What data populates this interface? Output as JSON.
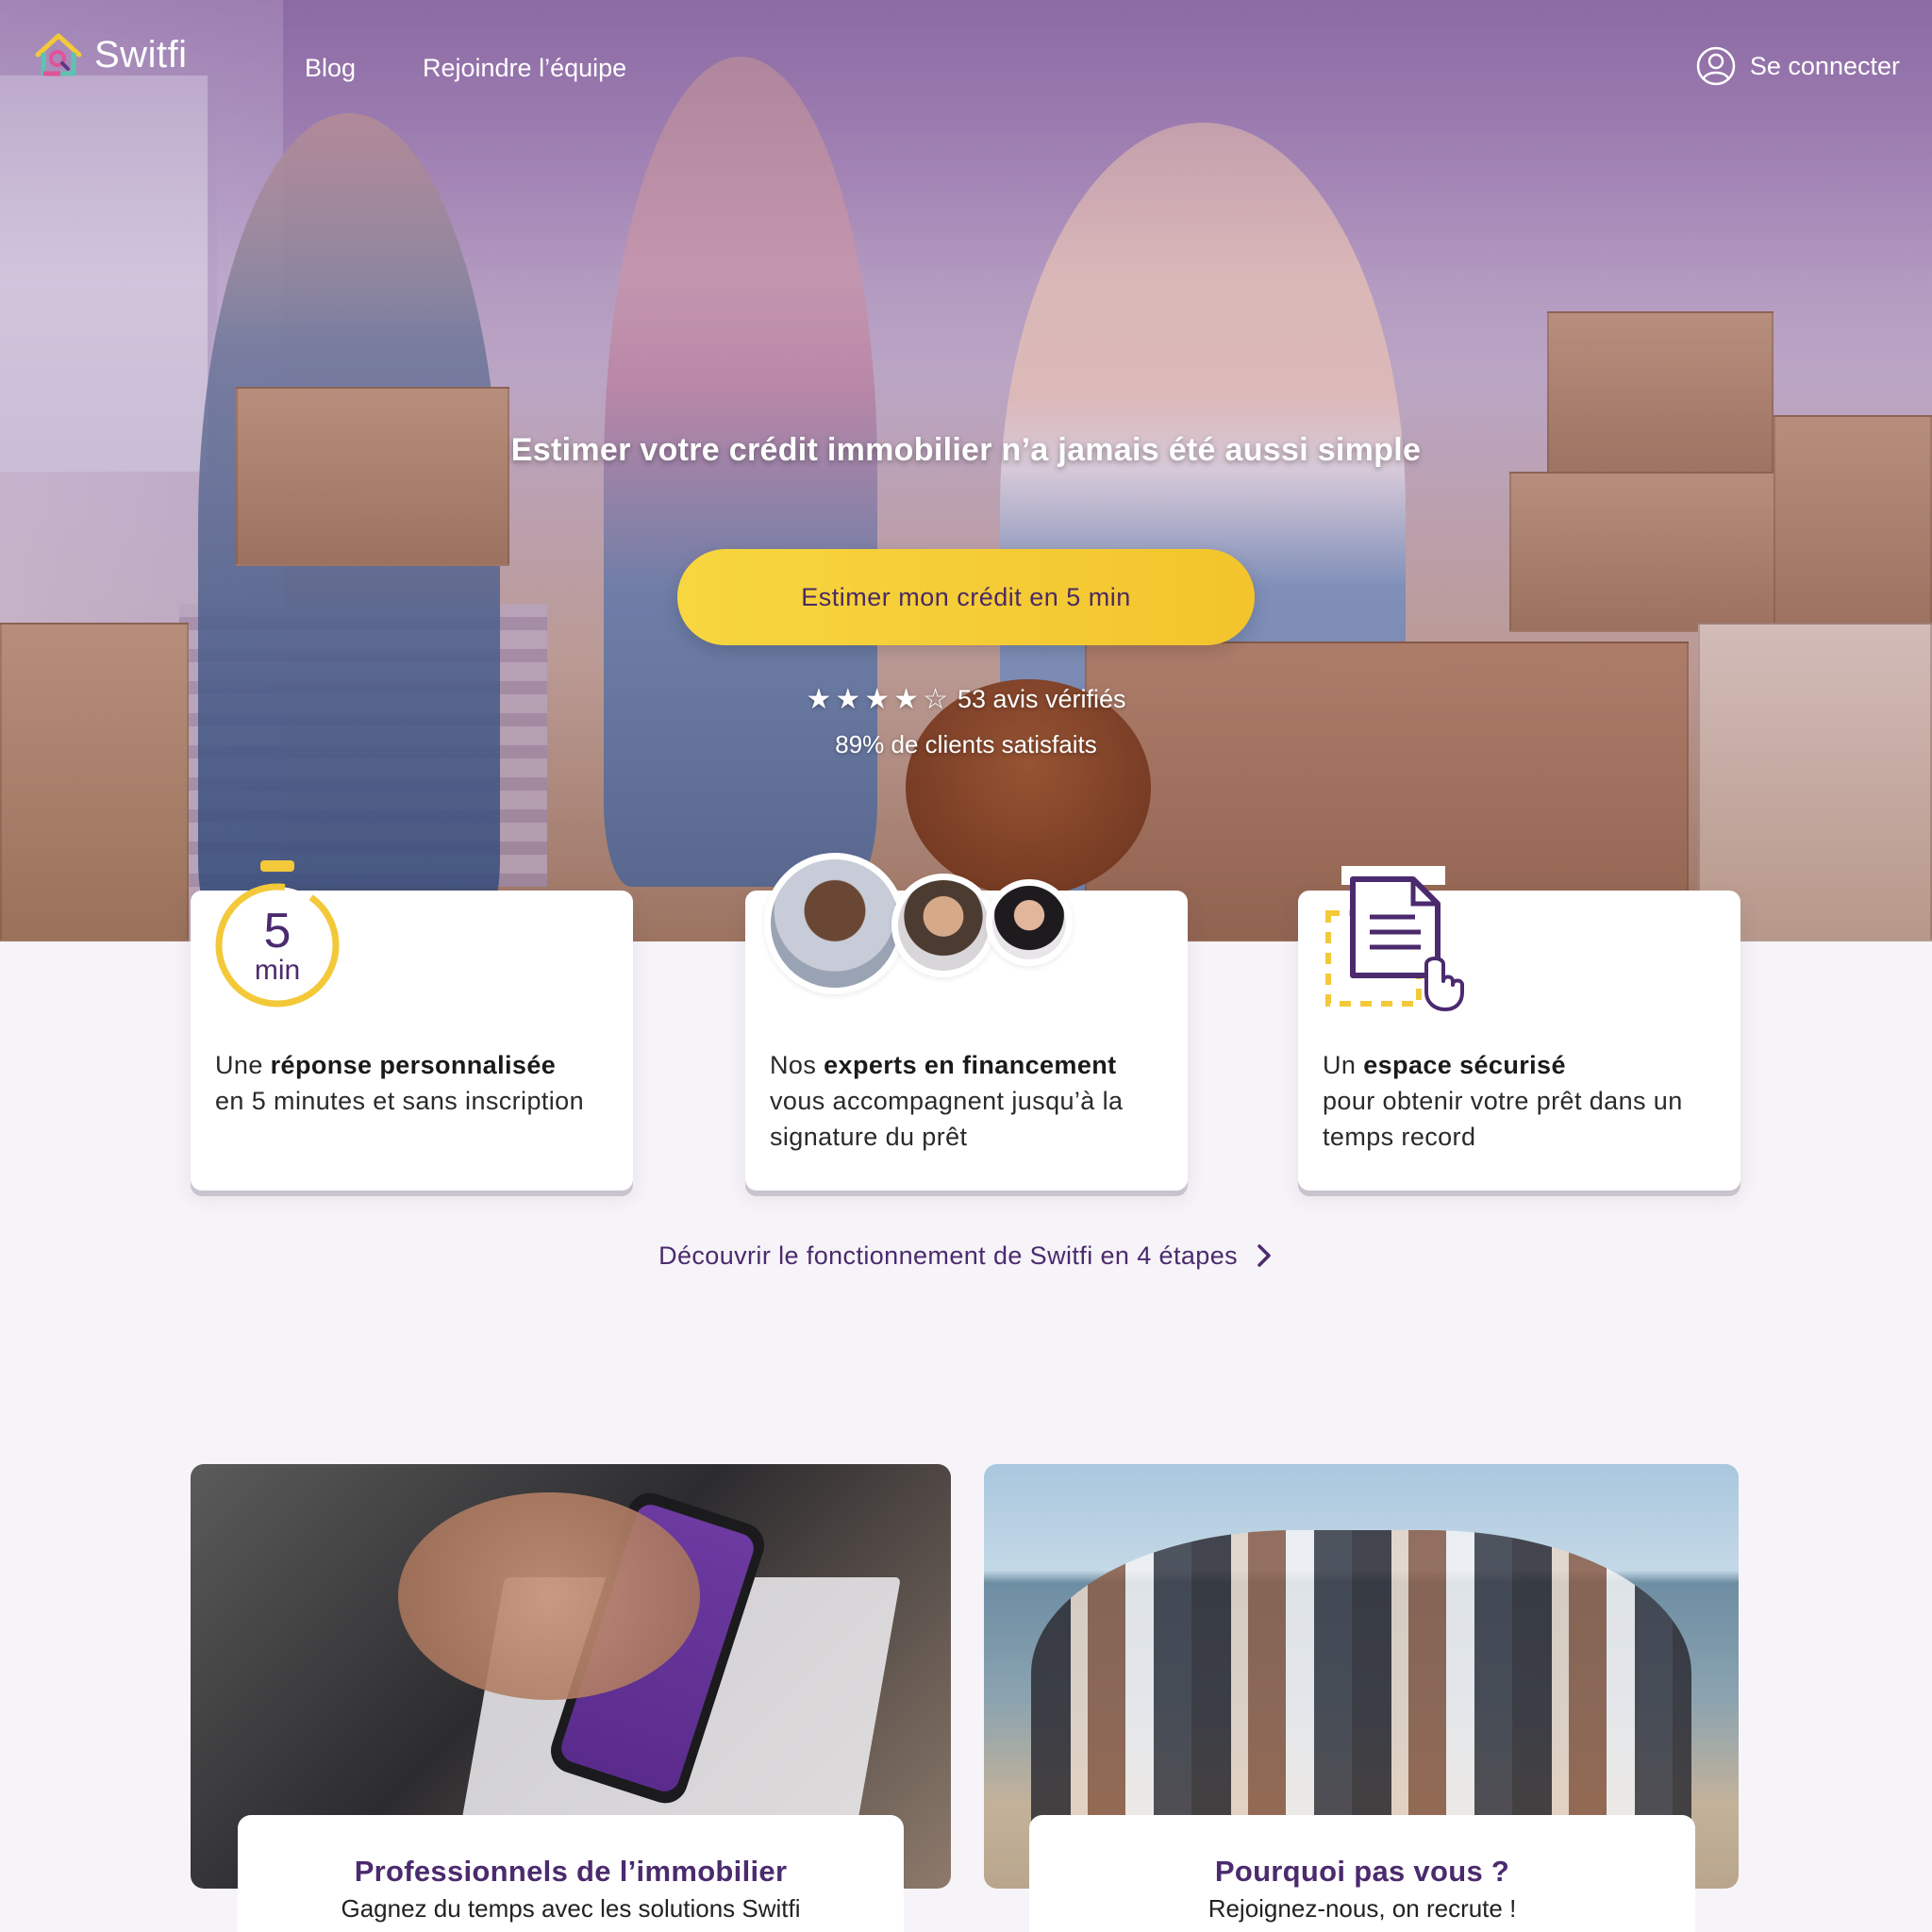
{
  "brand": {
    "name": "Switfi"
  },
  "nav": {
    "blog": "Blog",
    "join": "Rejoindre l’équipe",
    "login": "Se connecter"
  },
  "hero": {
    "title": "Estimer votre crédit immobilier n’a jamais été aussi simple",
    "cta": "Estimer mon crédit en 5 min",
    "rating": {
      "stars": 4,
      "max": 5,
      "reviews": "53 avis vérifiés"
    },
    "satisfaction": "89% de clients satisfaits"
  },
  "features": [
    {
      "icon": "timer-5min-icon",
      "timer_number": "5",
      "timer_unit": "min",
      "pre": "Une ",
      "bold": "réponse personnalisée",
      "rest": "en 5 minutes et sans inscription"
    },
    {
      "icon": "experts-avatars",
      "pre": "Nos ",
      "bold": "experts en financement",
      "rest": "vous accompagnent jusqu’à la signature du prêt"
    },
    {
      "icon": "secure-document-icon",
      "pre": "Un ",
      "bold": "espace sécurisé",
      "rest": "pour obtenir votre prêt dans un temps record"
    }
  ],
  "discover": {
    "label": "Découvrir le fonctionnement de Switfi en 4 étapes"
  },
  "promos": [
    {
      "title": "Professionnels de l’immobilier",
      "subtitle": "Gagnez du temps avec les solutions Switfi"
    },
    {
      "title": "Pourquoi pas vous ?",
      "subtitle": "Rejoignez-nous, on recrute !"
    }
  ],
  "colors": {
    "brand_purple": "#4b2a6e",
    "cta_yellow": "#f5cd36",
    "timer_yellow": "#f3c93a",
    "background": "#f6f4f8"
  }
}
